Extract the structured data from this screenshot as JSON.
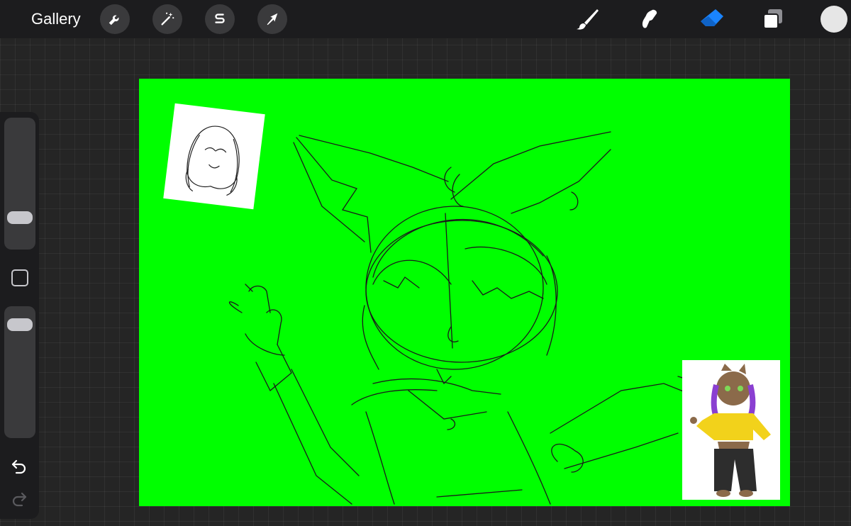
{
  "toolbar": {
    "gallery_label": "Gallery",
    "left_tools": [
      "wrench-icon",
      "magic-wand-icon",
      "selection-s-icon",
      "transform-arrow-icon"
    ],
    "right_tools": [
      "brush-icon",
      "smudge-icon",
      "eraser-icon",
      "layers-icon"
    ],
    "active_tool": "eraser",
    "accent_color": "#1a84ff"
  },
  "color": {
    "current": "#e6e6e6"
  },
  "sidebar": {
    "brush_size_level": 0.2,
    "opacity_level": 0.92,
    "icons": [
      "square-modifier-icon",
      "undo-icon",
      "redo-icon"
    ]
  },
  "canvas": {
    "background_color": "#00ff00"
  }
}
